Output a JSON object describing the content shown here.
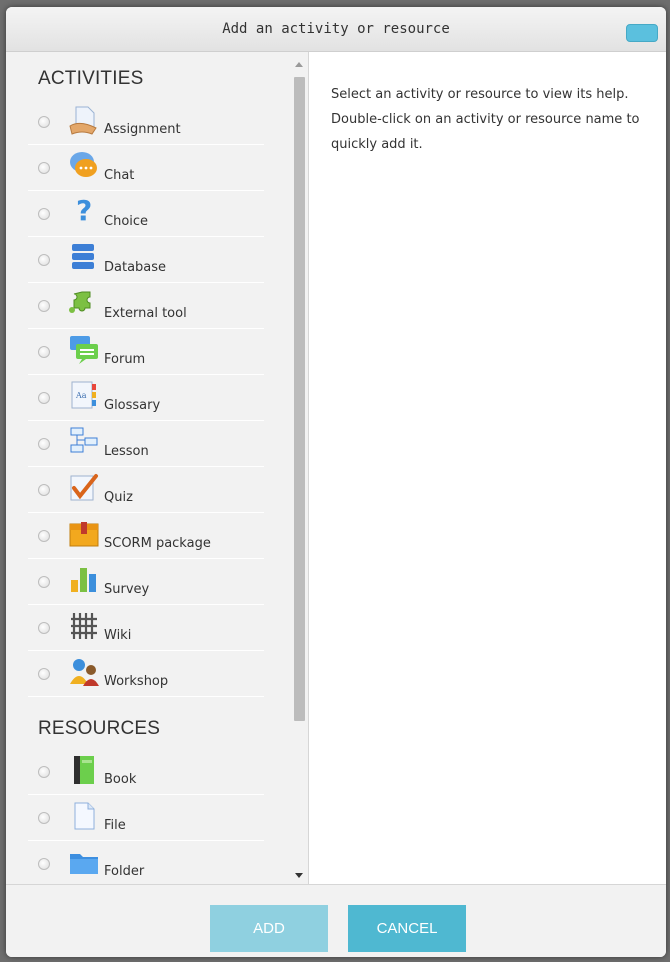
{
  "dialog": {
    "title": "Add an activity or resource"
  },
  "activities": {
    "heading": "ACTIVITIES",
    "items": [
      {
        "label": "Assignment",
        "icon": "assignment-icon"
      },
      {
        "label": "Chat",
        "icon": "chat-icon"
      },
      {
        "label": "Choice",
        "icon": "choice-icon"
      },
      {
        "label": "Database",
        "icon": "database-icon"
      },
      {
        "label": "External tool",
        "icon": "external-tool-icon"
      },
      {
        "label": "Forum",
        "icon": "forum-icon"
      },
      {
        "label": "Glossary",
        "icon": "glossary-icon"
      },
      {
        "label": "Lesson",
        "icon": "lesson-icon"
      },
      {
        "label": "Quiz",
        "icon": "quiz-icon"
      },
      {
        "label": "SCORM package",
        "icon": "scorm-package-icon"
      },
      {
        "label": "Survey",
        "icon": "survey-icon"
      },
      {
        "label": "Wiki",
        "icon": "wiki-icon"
      },
      {
        "label": "Workshop",
        "icon": "workshop-icon"
      }
    ]
  },
  "resources": {
    "heading": "RESOURCES",
    "items": [
      {
        "label": "Book",
        "icon": "book-icon"
      },
      {
        "label": "File",
        "icon": "file-icon"
      },
      {
        "label": "Folder",
        "icon": "folder-icon"
      }
    ]
  },
  "help": {
    "text": "Select an activity or resource to view its help. Double-click on an activity or resource name to quickly add it."
  },
  "footer": {
    "add_label": "ADD",
    "cancel_label": "CANCEL"
  },
  "colors": {
    "accent": "#4fb8d1",
    "accent_disabled": "#8fd0e0",
    "close": "#5bc0de"
  }
}
